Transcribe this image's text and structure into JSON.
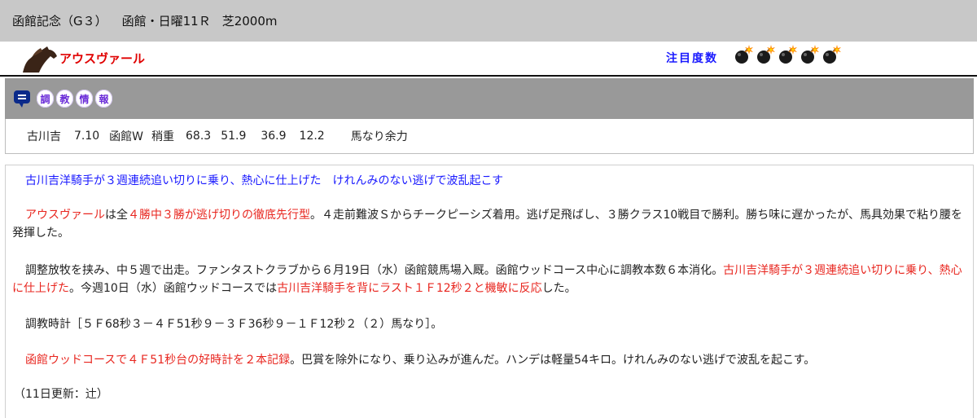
{
  "race": {
    "name": "函館記念（G３）",
    "venue": "函館・日曜11Ｒ",
    "distance": "芝2000m"
  },
  "horse": {
    "name": "アウスヴァール",
    "icon": "horse-icon"
  },
  "attention": {
    "label": "注目度数",
    "bomb_count": 5,
    "icon": "bomb-icon"
  },
  "training": {
    "section_icon": "speech-bubble-icon",
    "section_title_chars": [
      "調",
      "教",
      "情",
      "報"
    ],
    "record": {
      "rider": "古川吉",
      "date": "7.10",
      "course": "函館W",
      "track": "稍重",
      "time_5f": "68.3",
      "time_4f": "51.9",
      "time_3f": "36.9",
      "time_1f": "12.2",
      "manner": "馬なり余力"
    }
  },
  "comment": {
    "headline": "古川吉洋騎手が３週連続追い切りに乗り、熱心に仕上げた　けれんみのない逃げで波乱起こす",
    "p1": {
      "horse": "アウスヴァール",
      "a": "は全",
      "b": "４勝中３勝が逃げ切りの徹底先行型",
      "c": "。４走前難波Ｓからチークピーシズ着用。逃げ足飛ばし、３勝クラス10戦目で勝利。勝ち味に遅かったが、馬具効果で粘り腰を発揮した。"
    },
    "p2": {
      "a": "調整放牧を挟み、中５週で出走。ファンタストクラブから６月19日（水）函館競馬場入厩。函館ウッドコース中心に調教本数６本消化。",
      "b": "古川吉洋騎手が３週連続追い切りに乗り、熱心に仕上げた",
      "c": "。今週10日（水）函館ウッドコースでは",
      "d": "古川吉洋騎手を背にラスト１Ｆ12秒２と機敏に反応",
      "e": "した。"
    },
    "p3": "調教時計［５Ｆ68秒３－４Ｆ51秒９－３Ｆ36秒９－１Ｆ12秒２（２）馬なり］。",
    "p4": {
      "a": "函館ウッドコースで４Ｆ51秒台の好時計を２本記録",
      "b": "。巴賞を除外になり、乗り込みが進んだ。ハンデは軽量54キロ。けれんみのない逃げで波乱を起こす。"
    },
    "updated": "（11日更新：辻）"
  }
}
